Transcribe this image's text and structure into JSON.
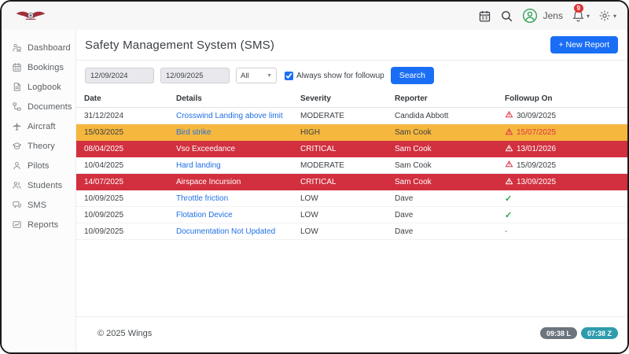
{
  "topbar": {
    "user_name": "Jens",
    "notification_count": "9"
  },
  "sidebar": {
    "items": [
      {
        "label": "Dashboard",
        "icon": "dashboard-icon"
      },
      {
        "label": "Bookings",
        "icon": "calendar-icon"
      },
      {
        "label": "Logbook",
        "icon": "document-icon"
      },
      {
        "label": "Documents",
        "icon": "tree-icon"
      },
      {
        "label": "Aircraft",
        "icon": "plane-icon"
      },
      {
        "label": "Theory",
        "icon": "graduation-cap-icon"
      },
      {
        "label": "Pilots",
        "icon": "person-icon"
      },
      {
        "label": "Students",
        "icon": "people-icon"
      },
      {
        "label": "SMS",
        "icon": "chat-icon"
      },
      {
        "label": "Reports",
        "icon": "chart-icon"
      }
    ]
  },
  "header": {
    "title": "Safety Management System (SMS)",
    "new_report_label": "+ New Report"
  },
  "filters": {
    "date_from": "12/09/2024",
    "date_to": "12/09/2025",
    "severity_selected": "All",
    "followup_checkbox_label": "Always show for followup",
    "followup_checked": true,
    "search_label": "Search"
  },
  "table": {
    "columns": [
      "Date",
      "Details",
      "Severity",
      "Reporter",
      "Followup On"
    ],
    "rows": [
      {
        "date": "31/12/2024",
        "details": "Crosswind Landing above limit",
        "severity": "MODERATE",
        "reporter": "Candida Abbott",
        "followup": "30/09/2025",
        "followup_icon": "warning",
        "highlight": "none"
      },
      {
        "date": "15/03/2025",
        "details": "Bird strike",
        "severity": "HIGH",
        "reporter": "Sam Cook",
        "followup": "15/07/2025",
        "followup_icon": "warning",
        "highlight": "high"
      },
      {
        "date": "08/04/2025",
        "details": "Vso Exceedance",
        "severity": "CRITICAL",
        "reporter": "Sam Cook",
        "followup": "13/01/2026",
        "followup_icon": "warning",
        "highlight": "critical"
      },
      {
        "date": "10/04/2025",
        "details": "Hard landing",
        "severity": "MODERATE",
        "reporter": "Sam Cook",
        "followup": "15/09/2025",
        "followup_icon": "warning",
        "highlight": "none"
      },
      {
        "date": "14/07/2025",
        "details": "Airspace Incursion",
        "severity": "CRITICAL",
        "reporter": "Sam Cook",
        "followup": "13/09/2025",
        "followup_icon": "warning",
        "highlight": "critical"
      },
      {
        "date": "10/09/2025",
        "details": "Throttle friction",
        "severity": "LOW",
        "reporter": "Dave",
        "followup": "",
        "followup_icon": "check",
        "highlight": "none"
      },
      {
        "date": "10/09/2025",
        "details": "Flotation Device",
        "severity": "LOW",
        "reporter": "Dave",
        "followup": "",
        "followup_icon": "check",
        "highlight": "none"
      },
      {
        "date": "10/09/2025",
        "details": "Documentation Not Updated",
        "severity": "LOW",
        "reporter": "Dave",
        "followup": "-",
        "followup_icon": "dash",
        "highlight": "none"
      }
    ]
  },
  "footer": {
    "copyright": "© 2025 Wings",
    "local_time": "09:38 L",
    "zulu_time": "07:38 Z"
  },
  "colors": {
    "accent_blue": "#1a6ef5",
    "link_blue": "#1f6fe5",
    "row_high": "#f5b73e",
    "row_critical": "#d2303f",
    "warning_red": "#dc3545",
    "check_green": "#28a745",
    "badge_gray": "#6c757d",
    "badge_teal": "#2e9cad",
    "notification_red": "#e03131",
    "avatar_green": "#35a157"
  }
}
